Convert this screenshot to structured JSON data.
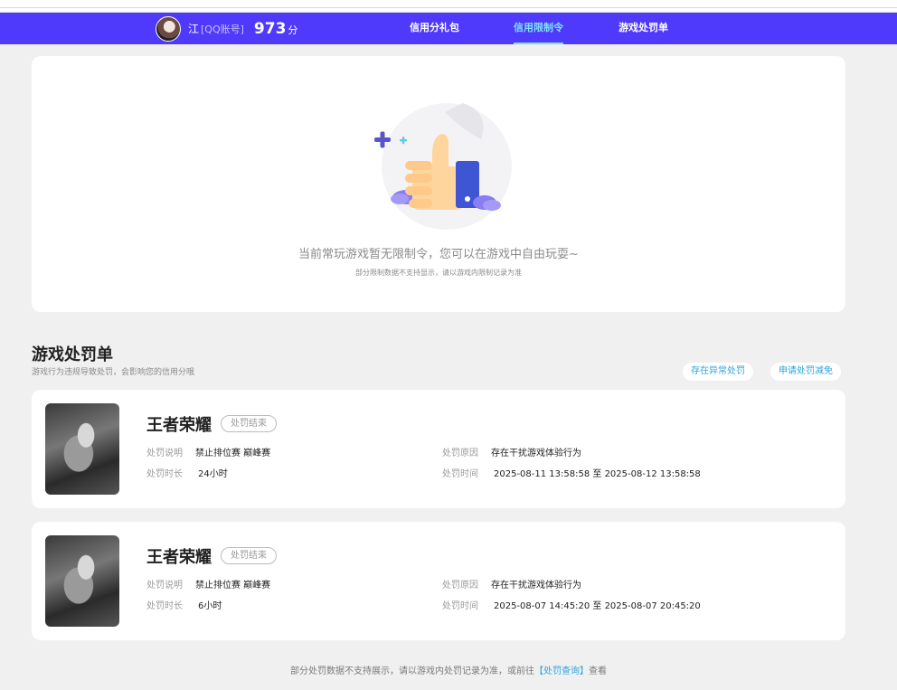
{
  "header": {
    "user_name": "江",
    "account_type": "[QQ账号]",
    "score": "973",
    "score_unit": "分",
    "tabs": [
      {
        "label": "信用分礼包"
      },
      {
        "label": "信用限制令"
      },
      {
        "label": "游戏处罚单"
      }
    ],
    "active_tab_color": "#7fe0ff",
    "bar_color": "#4f39fb"
  },
  "hero": {
    "main_text": "当前常玩游戏暂无限制令，您可以在游戏中自由玩耍~",
    "sub_text": "部分限制数据不支持显示，请以游戏内限制记录为准"
  },
  "penalty_section": {
    "title": "游戏处罚单",
    "subtitle": "游戏行为违规导致处罚，会影响您的信用分哦",
    "abnormal_button": "存在异常处罚",
    "appeal_button": "申请处罚减免"
  },
  "penalties": [
    {
      "game": "王者荣耀",
      "status": "处罚结束",
      "desc_label": "处罚说明",
      "desc": "禁止排位赛 巅峰赛",
      "duration_label": "处罚时长",
      "duration": "24小时",
      "reason_label": "处罚原因",
      "reason": "存在干扰游戏体验行为",
      "time_label": "处罚时间",
      "time": "2025-08-11 13:58:58 至 2025-08-12 13:58:58"
    },
    {
      "game": "王者荣耀",
      "status": "处罚结束",
      "desc_label": "处罚说明",
      "desc": "禁止排位赛 巅峰赛",
      "duration_label": "处罚时长",
      "duration": "6小时",
      "reason_label": "处罚原因",
      "reason": "存在干扰游戏体验行为",
      "time_label": "处罚时间",
      "time": "2025-08-07 14:45:20 至 2025-08-07 20:45:20"
    }
  ],
  "footer": {
    "text_before": "部分处罚数据不支持展示，请以游戏内处罚记录为准，或前往",
    "link": "【处罚查询】",
    "text_after": "查看"
  }
}
